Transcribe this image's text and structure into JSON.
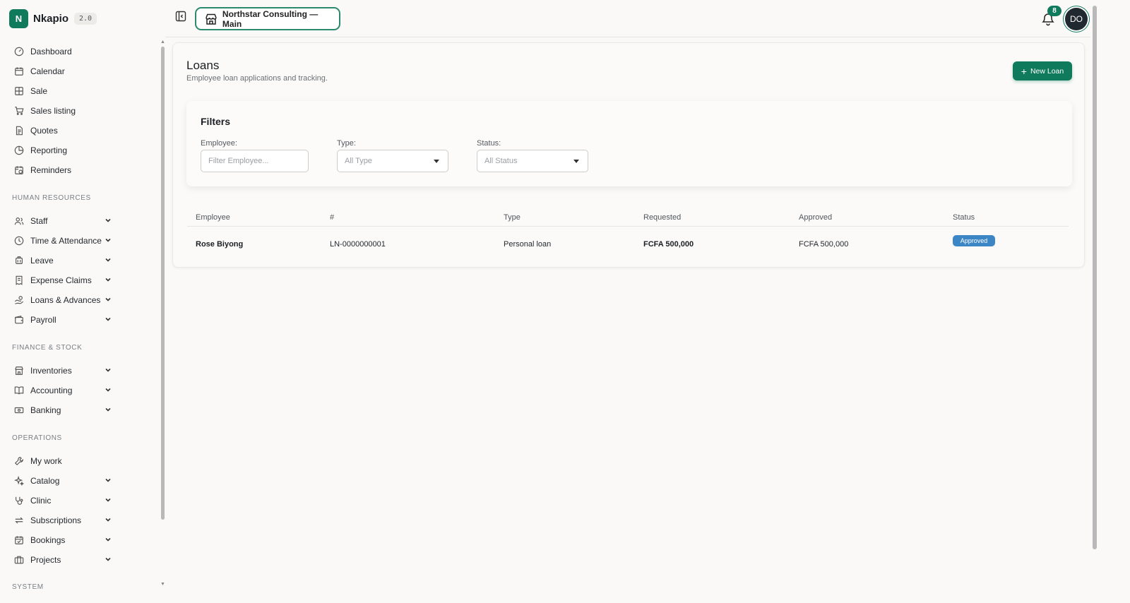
{
  "brand": {
    "logo_letter": "N",
    "name": "Nkapio",
    "version": "2.0"
  },
  "sidebar": {
    "main_items": [
      {
        "label": "Dashboard",
        "icon": "gauge-icon"
      },
      {
        "label": "Calendar",
        "icon": "calendar-icon"
      },
      {
        "label": "Sale",
        "icon": "grid-plus-icon"
      },
      {
        "label": "Sales listing",
        "icon": "cart-icon"
      },
      {
        "label": "Quotes",
        "icon": "document-icon"
      },
      {
        "label": "Reporting",
        "icon": "pie-chart-icon"
      },
      {
        "label": "Reminders",
        "icon": "calendar-clock-icon"
      }
    ],
    "sections": [
      {
        "label": "HUMAN RESOURCES",
        "items": [
          {
            "label": "Staff",
            "icon": "users-icon"
          },
          {
            "label": "Time & Attendance",
            "icon": "clock-icon"
          },
          {
            "label": "Leave",
            "icon": "plane-icon"
          },
          {
            "label": "Expense Claims",
            "icon": "receipt-icon"
          },
          {
            "label": "Loans & Advances",
            "icon": "hand-coins-icon"
          },
          {
            "label": "Payroll",
            "icon": "wallet-icon"
          }
        ]
      },
      {
        "label": "FINANCE & STOCK",
        "items": [
          {
            "label": "Inventories",
            "icon": "store-icon"
          },
          {
            "label": "Accounting",
            "icon": "book-icon"
          },
          {
            "label": "Banking",
            "icon": "banknote-icon"
          }
        ]
      },
      {
        "label": "OPERATIONS",
        "items": [
          {
            "label": "My work",
            "icon": "wrench-icon"
          },
          {
            "label": "Catalog",
            "icon": "sparkles-icon"
          },
          {
            "label": "Clinic",
            "icon": "stethoscope-icon"
          },
          {
            "label": "Subscriptions",
            "icon": "repeat-icon"
          },
          {
            "label": "Bookings",
            "icon": "calendar-check-icon"
          },
          {
            "label": "Projects",
            "icon": "briefcase-icon"
          }
        ]
      },
      {
        "label": "SYSTEM",
        "items": []
      }
    ]
  },
  "topbar": {
    "org_name": "Northstar Consulting — Main",
    "notification_count": "8",
    "avatar_initials": "DO"
  },
  "page": {
    "title": "Loans",
    "subtitle": "Employee loan applications and tracking.",
    "new_button_label": "New Loan"
  },
  "filters": {
    "title": "Filters",
    "employee_label": "Employee:",
    "employee_placeholder": "Filter Employee...",
    "type_label": "Type:",
    "type_value": "All Type",
    "status_label": "Status:",
    "status_value": "All Status"
  },
  "table": {
    "columns": [
      "Employee",
      "#",
      "Type",
      "Requested",
      "Approved",
      "Status"
    ],
    "rows": [
      {
        "employee": "Rose Biyong",
        "number": "LN-0000000001",
        "type": "Personal loan",
        "requested": "FCFA 500,000",
        "approved": "FCFA 500,000",
        "status": "Approved"
      }
    ]
  },
  "colors": {
    "accent": "#0f7a5c",
    "status_approved": "#3d86c6"
  }
}
